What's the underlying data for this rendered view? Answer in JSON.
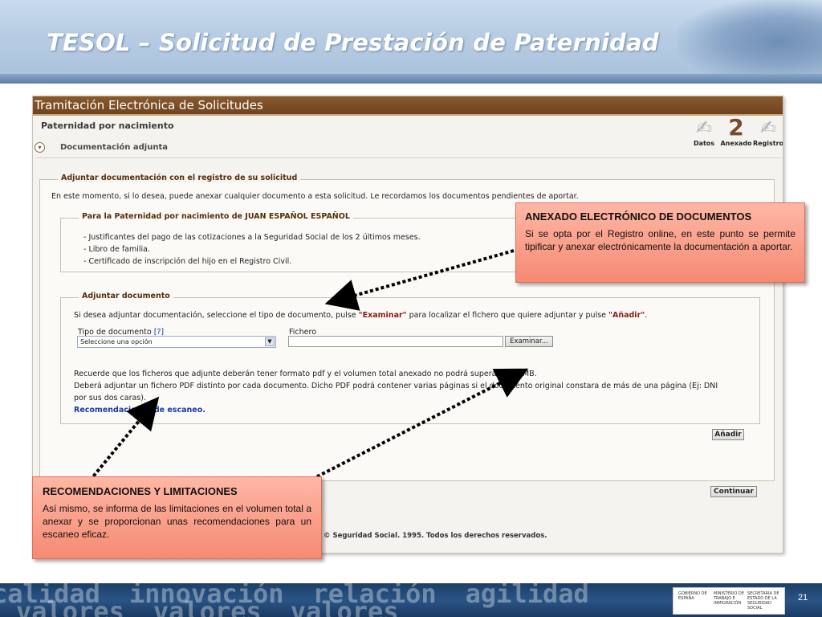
{
  "slide": {
    "title": "TESOL – Solicitud de Prestación de Paternidad",
    "page_number": "21"
  },
  "app": {
    "header": "Tramitación Electrónica de Solicitudes",
    "section_title": "Paternidad por nacimiento",
    "subsection": "Documentación adjunta",
    "toggle_icon": "▾",
    "steps": [
      {
        "icon": "✍",
        "label": "Datos"
      },
      {
        "icon": "2",
        "label": "Anexado"
      },
      {
        "icon": "✍",
        "label": "Registro"
      }
    ],
    "adjuntar_registro": {
      "legend": "Adjuntar documentación con el registro de su solicitud",
      "intro": "En este momento, si lo desea, puede anexar cualquier documento a esta solicitud. Le recordamos los documentos pendientes de aportar."
    },
    "pendientes": {
      "legend": "Para la Paternidad por nacimiento de JUAN ESPAÑOL ESPAÑOL",
      "items": [
        "- Justificantes del pago de las cotizaciones a la Seguridad Social de los 2 últimos meses.",
        "- Libro de familia.",
        "- Certificado de inscripción del hijo en el Registro Civil."
      ]
    },
    "adjuntar_documento": {
      "legend": "Adjuntar documento",
      "instr_pre": "Si desea adjuntar documentación, seleccione el tipo de documento, pulse ",
      "instr_examinar": "\"Examinar\"",
      "instr_mid": " para localizar el fichero que quiere adjuntar y pulse ",
      "instr_anadir": "\"Añadir\"",
      "instr_post": ".",
      "tipo_label": "Tipo de documento",
      "tipo_help": "[?]",
      "tipo_value": "Seleccione una opción",
      "fichero_label": "Fichero",
      "examinar_button": "Examinar...",
      "note_1": "Recuerde que los ficheros que adjunte deberán tener formato pdf y el volumen total anexado no podrá superar los 4 MB.",
      "note_2": "Deberá adjuntar un fichero PDF distinto por cada documento. Dicho PDF podrá contener varias páginas si el documento original constara de más de una página (Ej: DNI",
      "note_3": "por sus dos caras).",
      "recomendaciones_link": "Recomendaciones de escaneo.",
      "anadir_button": "Añadir"
    },
    "continuar_button": "Continuar",
    "copyright": "© Seguridad Social. 1995. Todos los derechos reservados."
  },
  "callouts": {
    "anexado": {
      "title": "ANEXADO ELECTRÓNICO DE DOCUMENTOS",
      "body": "Si se opta por el Registro online, en este punto se permite tipificar y anexar electrónicamente la documentación a aportar."
    },
    "recomendaciones": {
      "title": "RECOMENDACIONES Y LIMITACIONES",
      "body": "Así mismo, se informa de las limitaciones en el volumen total a anexar y se proporcionan unas recomendaciones para un escaneo eficaz."
    }
  },
  "footer": {
    "words": [
      "calidad",
      "innovación",
      "relación",
      "agilidad",
      "valores",
      "valores",
      "valores"
    ],
    "logos": [
      "GOBIERNO DE ESPAÑA",
      "MINISTERIO DE TRABAJO E INMIGRACIÓN",
      "SECRETARÍA DE ESTADO DE LA SEGURIDAD SOCIAL"
    ]
  }
}
